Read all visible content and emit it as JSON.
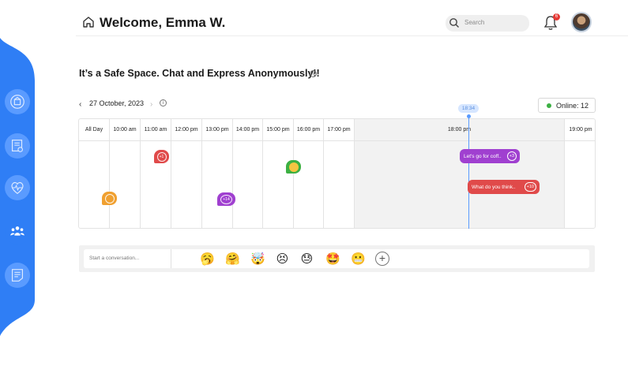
{
  "header": {
    "welcome": "Welcome, Emma W.",
    "search_placeholder": "Search",
    "notification_count": "6"
  },
  "page": {
    "title": "It’s a Safe Space. Chat and Express Anonymously!!"
  },
  "date_nav": {
    "date": "27 October, 2023"
  },
  "online": {
    "label": "Online: 12",
    "dot_color": "#3cb043"
  },
  "timeline": {
    "current_time": "18:34",
    "columns": [
      "All Day",
      "10:00 am",
      "11:00 am",
      "12:00 pm",
      "13:00 pm",
      "14:00 pm",
      "15:00 pm",
      "16:00 pm",
      "17:00 pm",
      "18:00 pm",
      "19:00 pm"
    ],
    "markers": [
      {
        "count": "+1",
        "color": "#e04a4a"
      },
      {
        "count": "",
        "color": "#3cb043"
      },
      {
        "count": "",
        "color": "#f0a030"
      },
      {
        "count": "+14",
        "color": "#a040d0"
      }
    ],
    "pills": [
      {
        "text": "Let's go for coff..",
        "count": "+3",
        "color": "#a040d0"
      },
      {
        "text": "What do you think..",
        "count": "+10",
        "color": "#e04a4a"
      }
    ]
  },
  "composer": {
    "placeholder": "Start a conversation...",
    "emojis": [
      "🥱",
      "🤗",
      "🤯",
      "😣",
      "😓",
      "🤩",
      "😬"
    ]
  },
  "colors": {
    "sidebar": "#2f7ef5",
    "accent": "#5a9bff"
  }
}
